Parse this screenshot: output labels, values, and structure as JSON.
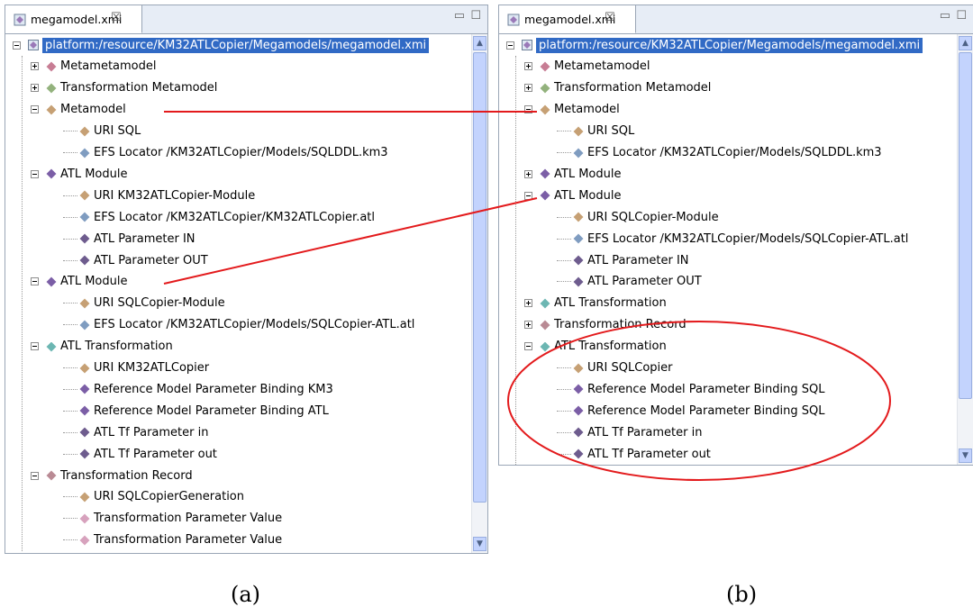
{
  "panels": [
    {
      "tab_title": "megamodel.xmi",
      "close_symbol": "☒",
      "minimize_symbol": "▭",
      "maximize_symbol": "☐",
      "caption": "(a)",
      "rows": [
        {
          "label": "platform:/resource/KM32ATLCopier/Megamodels/megamodel.xmi",
          "level": 0,
          "expander": "minus",
          "icon": "megamodel",
          "color": "#8f8f8f",
          "selected": true
        },
        {
          "label": "Metametamodel",
          "level": 1,
          "expander": "plus",
          "color": "#c77d94"
        },
        {
          "label": "Transformation Metamodel",
          "level": 1,
          "expander": "plus",
          "color": "#93b27d"
        },
        {
          "label": "Metamodel",
          "level": 1,
          "expander": "minus",
          "color": "#c6a074"
        },
        {
          "label": "URI SQL",
          "level": 2,
          "color": "#c6a074"
        },
        {
          "label": "EFS Locator /KM32ATLCopier/Models/SQLDDL.km3",
          "level": 2,
          "color": "#7f9cc0"
        },
        {
          "label": "ATL Module",
          "level": 1,
          "expander": "minus",
          "color": "#7b5ea6"
        },
        {
          "label": "URI KM32ATLCopier-Module",
          "level": 2,
          "color": "#c6a074"
        },
        {
          "label": "EFS Locator /KM32ATLCopier/KM32ATLCopier.atl",
          "level": 2,
          "color": "#7f9cc0"
        },
        {
          "label": "ATL Parameter IN",
          "level": 2,
          "color": "#6e5c8e"
        },
        {
          "label": "ATL Parameter OUT",
          "level": 2,
          "color": "#6e5c8e"
        },
        {
          "label": "ATL Module",
          "level": 1,
          "expander": "minus",
          "color": "#7b5ea6"
        },
        {
          "label": "URI SQLCopier-Module",
          "level": 2,
          "color": "#c6a074"
        },
        {
          "label": "EFS Locator /KM32ATLCopier/Models/SQLCopier-ATL.atl",
          "level": 2,
          "color": "#7f9cc0"
        },
        {
          "label": "ATL Transformation",
          "level": 1,
          "expander": "minus",
          "color": "#6cb6b2"
        },
        {
          "label": "URI KM32ATLCopier",
          "level": 2,
          "color": "#c6a074"
        },
        {
          "label": "Reference Model Parameter Binding KM3",
          "level": 2,
          "color": "#7b5ea6"
        },
        {
          "label": "Reference Model Parameter Binding ATL",
          "level": 2,
          "color": "#7b5ea6"
        },
        {
          "label": "ATL Tf Parameter in",
          "level": 2,
          "color": "#6e5c8e"
        },
        {
          "label": "ATL Tf Parameter out",
          "level": 2,
          "color": "#6e5c8e"
        },
        {
          "label": "Transformation Record",
          "level": 1,
          "expander": "minus",
          "color": "#b98a94"
        },
        {
          "label": "URI SQLCopierGeneration",
          "level": 2,
          "color": "#c6a074"
        },
        {
          "label": "Transformation Parameter Value",
          "level": 2,
          "color": "#d7a2bd"
        },
        {
          "label": "Transformation Parameter Value",
          "level": 2,
          "color": "#d7a2bd"
        }
      ]
    },
    {
      "tab_title": "megamodel.xmi",
      "close_symbol": "☒",
      "minimize_symbol": "▭",
      "maximize_symbol": "☐",
      "caption": "(b)",
      "rows": [
        {
          "label": "platform:/resource/KM32ATLCopier/Megamodels/megamodel.xmi",
          "level": 0,
          "expander": "minus",
          "icon": "megamodel",
          "color": "#8f8f8f",
          "selected": true
        },
        {
          "label": "Metametamodel",
          "level": 1,
          "expander": "plus",
          "color": "#c77d94"
        },
        {
          "label": "Transformation Metamodel",
          "level": 1,
          "expander": "plus",
          "color": "#93b27d"
        },
        {
          "label": "Metamodel",
          "level": 1,
          "expander": "minus",
          "color": "#c6a074"
        },
        {
          "label": "URI SQL",
          "level": 2,
          "color": "#c6a074"
        },
        {
          "label": "EFS Locator /KM32ATLCopier/Models/SQLDDL.km3",
          "level": 2,
          "color": "#7f9cc0"
        },
        {
          "label": "ATL Module",
          "level": 1,
          "expander": "plus",
          "color": "#7b5ea6"
        },
        {
          "label": "ATL Module",
          "level": 1,
          "expander": "minus",
          "color": "#7b5ea6"
        },
        {
          "label": "URI SQLCopier-Module",
          "level": 2,
          "color": "#c6a074"
        },
        {
          "label": "EFS Locator /KM32ATLCopier/Models/SQLCopier-ATL.atl",
          "level": 2,
          "color": "#7f9cc0"
        },
        {
          "label": "ATL Parameter IN",
          "level": 2,
          "color": "#6e5c8e"
        },
        {
          "label": "ATL Parameter OUT",
          "level": 2,
          "color": "#6e5c8e"
        },
        {
          "label": "ATL Transformation",
          "level": 1,
          "expander": "plus",
          "color": "#6cb6b2"
        },
        {
          "label": "Transformation Record",
          "level": 1,
          "expander": "plus",
          "color": "#b98a94"
        },
        {
          "label": "ATL Transformation",
          "level": 1,
          "expander": "minus",
          "color": "#6cb6b2"
        },
        {
          "label": "URI SQLCopier",
          "level": 2,
          "color": "#c6a074"
        },
        {
          "label": "Reference Model Parameter Binding SQL",
          "level": 2,
          "color": "#7b5ea6"
        },
        {
          "label": "Reference Model Parameter Binding SQL",
          "level": 2,
          "color": "#7b5ea6"
        },
        {
          "label": "ATL Tf Parameter in",
          "level": 2,
          "color": "#6e5c8e"
        },
        {
          "label": "ATL Tf Parameter out",
          "level": 2,
          "color": "#6e5c8e"
        }
      ]
    }
  ],
  "annotations": {
    "connector_color": "#e31a1c",
    "highlight_ellipse_color": "#e31a1c"
  }
}
